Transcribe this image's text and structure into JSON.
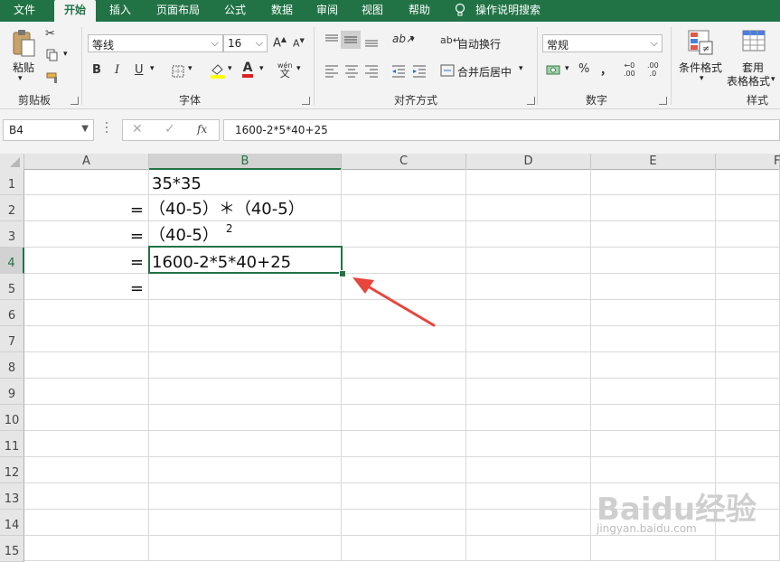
{
  "menu": {
    "tabs": [
      "文件",
      "开始",
      "插入",
      "页面布局",
      "公式",
      "数据",
      "审阅",
      "视图",
      "帮助"
    ],
    "search": "操作说明搜索"
  },
  "ribbon": {
    "clipboard": {
      "paste": "粘贴",
      "label": "剪贴板"
    },
    "font": {
      "name": "等线",
      "size": "16",
      "label": "字体",
      "bold": "B",
      "italic": "I",
      "underline": "U",
      "phonetic_top": "wén",
      "phonetic_bottom": "文",
      "grow": "A",
      "shrink": "A"
    },
    "alignment": {
      "wrap": "自动换行",
      "merge": "合并后居中",
      "label": "对齐方式"
    },
    "number": {
      "format": "常规",
      "percent": "%",
      "comma": "，",
      "inc_decimal": ".00",
      "dec_decimal": ".0",
      "label": "数字"
    },
    "styles": {
      "conditional": "条件格式",
      "table_top": "套用",
      "table_bottom": "表格格式",
      "label": "样式"
    }
  },
  "formula_bar": {
    "name_box": "B4",
    "formula": "1600-2*5*40+25",
    "fx": "fx"
  },
  "columns": [
    "A",
    "B",
    "C",
    "D",
    "E",
    "F"
  ],
  "rows": [
    "1",
    "2",
    "3",
    "4",
    "5",
    "6",
    "7",
    "8",
    "9",
    "10",
    "11",
    "12",
    "13",
    "14",
    "15"
  ],
  "cells": {
    "A2": "=",
    "A3": "=",
    "A4": "=",
    "A5": "=",
    "B1": "35*35",
    "B2": "（40-5）＊（40-5）",
    "B3": "（40-5）",
    "B3_sup": "2",
    "B4": "1600-2*5*40+25"
  },
  "watermark": {
    "main": "Baidu经验",
    "sub": "jingyan.baidu.com"
  },
  "colors": {
    "accent": "#217346",
    "arrow": "#e8453c"
  }
}
